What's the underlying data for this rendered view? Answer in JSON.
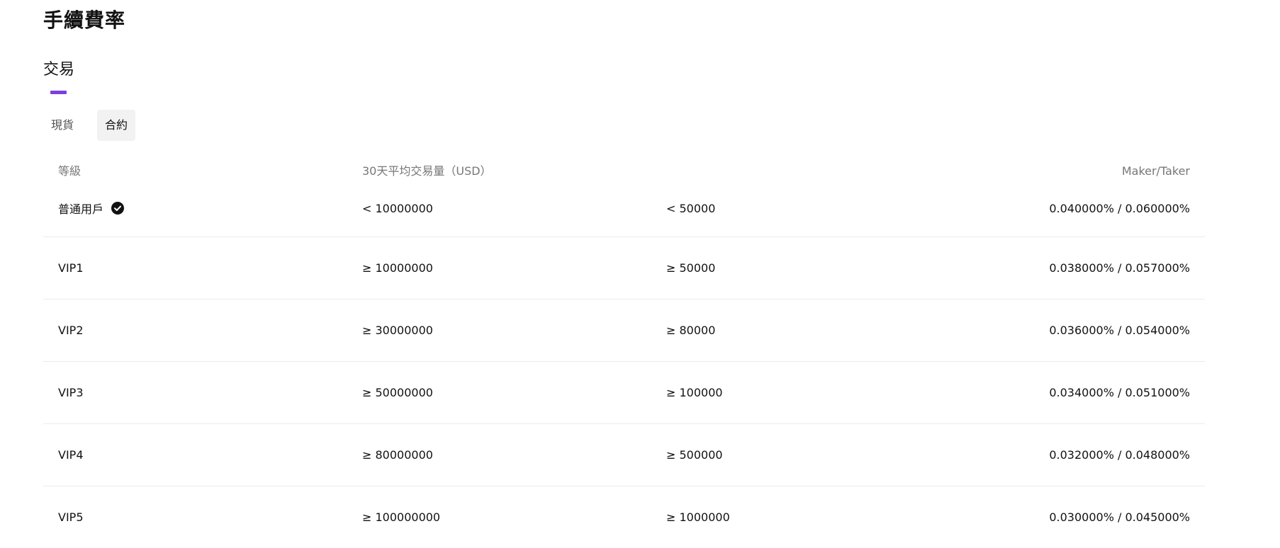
{
  "page": {
    "title": "手續費率",
    "section_title": "交易"
  },
  "tabs": [
    {
      "label": "現貨",
      "active": false
    },
    {
      "label": "合約",
      "active": true
    }
  ],
  "table": {
    "headers": [
      "等級",
      "30天平均交易量（USD）",
      "",
      "Maker/Taker"
    ],
    "rows": [
      {
        "level": "普通用戶",
        "current": true,
        "volume": "< 10000000",
        "second": "< 50000",
        "rate": "0.040000% / 0.060000%"
      },
      {
        "level": "VIP1",
        "current": false,
        "volume": "≥ 10000000",
        "second": "≥ 50000",
        "rate": "0.038000% / 0.057000%"
      },
      {
        "level": "VIP2",
        "current": false,
        "volume": "≥ 30000000",
        "second": "≥ 80000",
        "rate": "0.036000% / 0.054000%"
      },
      {
        "level": "VIP3",
        "current": false,
        "volume": "≥ 50000000",
        "second": "≥ 100000",
        "rate": "0.034000% / 0.051000%"
      },
      {
        "level": "VIP4",
        "current": false,
        "volume": "≥ 80000000",
        "second": "≥ 500000",
        "rate": "0.032000% / 0.048000%"
      },
      {
        "level": "VIP5",
        "current": false,
        "volume": "≥ 100000000",
        "second": "≥ 1000000",
        "rate": "0.030000% / 0.045000%"
      }
    ]
  },
  "icons": {
    "current_level": "check-circle-icon"
  },
  "colors": {
    "accent": "#7b3fe4",
    "text": "#121212",
    "muted": "#777777",
    "divider": "#ebebeb",
    "active_tab_bg": "#f2f2f2"
  }
}
